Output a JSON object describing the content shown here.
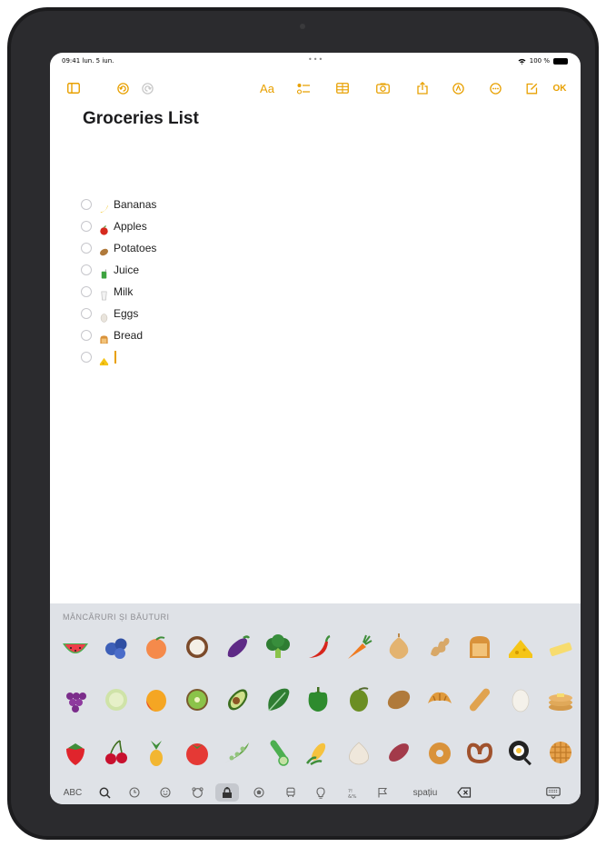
{
  "status": {
    "time": "09:41 lun. 5 iun.",
    "battery": "100 %"
  },
  "toolbar": {
    "text_format_label": "Aa",
    "done_label": "OK"
  },
  "note": {
    "title": "Groceries List",
    "items": [
      {
        "label": "Bananas",
        "emoji": "banana"
      },
      {
        "label": "Apples",
        "emoji": "apple"
      },
      {
        "label": "Potatoes",
        "emoji": "potato"
      },
      {
        "label": "Juice",
        "emoji": "juice-box"
      },
      {
        "label": "Milk",
        "emoji": "glass-of-milk"
      },
      {
        "label": "Eggs",
        "emoji": "egg"
      },
      {
        "label": "Bread",
        "emoji": "bread"
      },
      {
        "label": "",
        "emoji": "cheese"
      }
    ]
  },
  "keyboard": {
    "category": "MÂNCĂRURI ȘI BĂUTURI",
    "abc_label": "ABC",
    "space_label": "spațiu",
    "emoji_rows": [
      [
        "watermelon",
        "blueberries",
        "peach",
        "coconut",
        "eggplant",
        "broccoli",
        "hot-pepper",
        "carrot",
        "onion",
        "ginger",
        "bread",
        "cheese",
        "butter"
      ],
      [
        "grapes",
        "melon",
        "mango",
        "kiwi",
        "avocado",
        "leafy-green",
        "bell-pepper",
        "olive",
        "potato",
        "croissant",
        "baguette",
        "egg",
        "pancakes"
      ],
      [
        "strawberry",
        "cherries",
        "pineapple",
        "tomato",
        "pea-pod",
        "cucumber",
        "corn",
        "garlic",
        "sweet-potato",
        "bagel",
        "pretzel",
        "cooking",
        "waffle"
      ]
    ]
  },
  "colors": {
    "accent": "#e8a000",
    "keyboard_bg": "#dfe2e7"
  }
}
